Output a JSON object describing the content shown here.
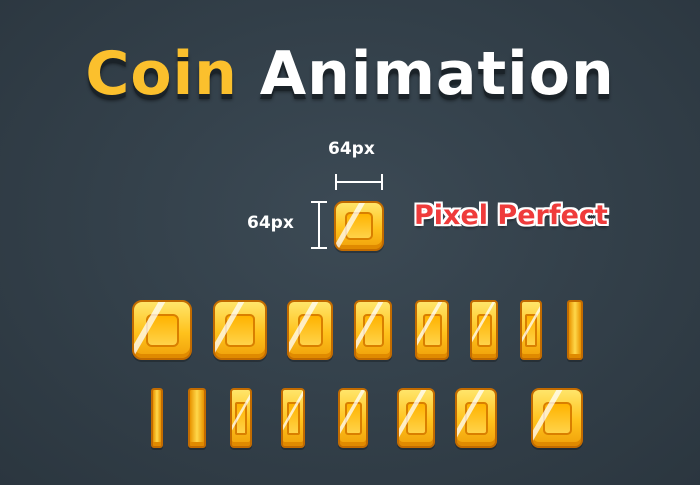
{
  "title": {
    "word1": "Coin",
    "word2": "Animation"
  },
  "size_label_width": "64px",
  "size_label_height": "64px",
  "badge": "Pixel Perfect",
  "colors": {
    "background": "#34414b",
    "title_accent": "#fbc02d",
    "title_main": "#ffffff",
    "badge_text": "#ef3b3b",
    "coin_gold": "#ffc21c",
    "coin_outline": "#c26b00"
  },
  "frames": {
    "row1_count": 8,
    "row2_count": 8
  }
}
